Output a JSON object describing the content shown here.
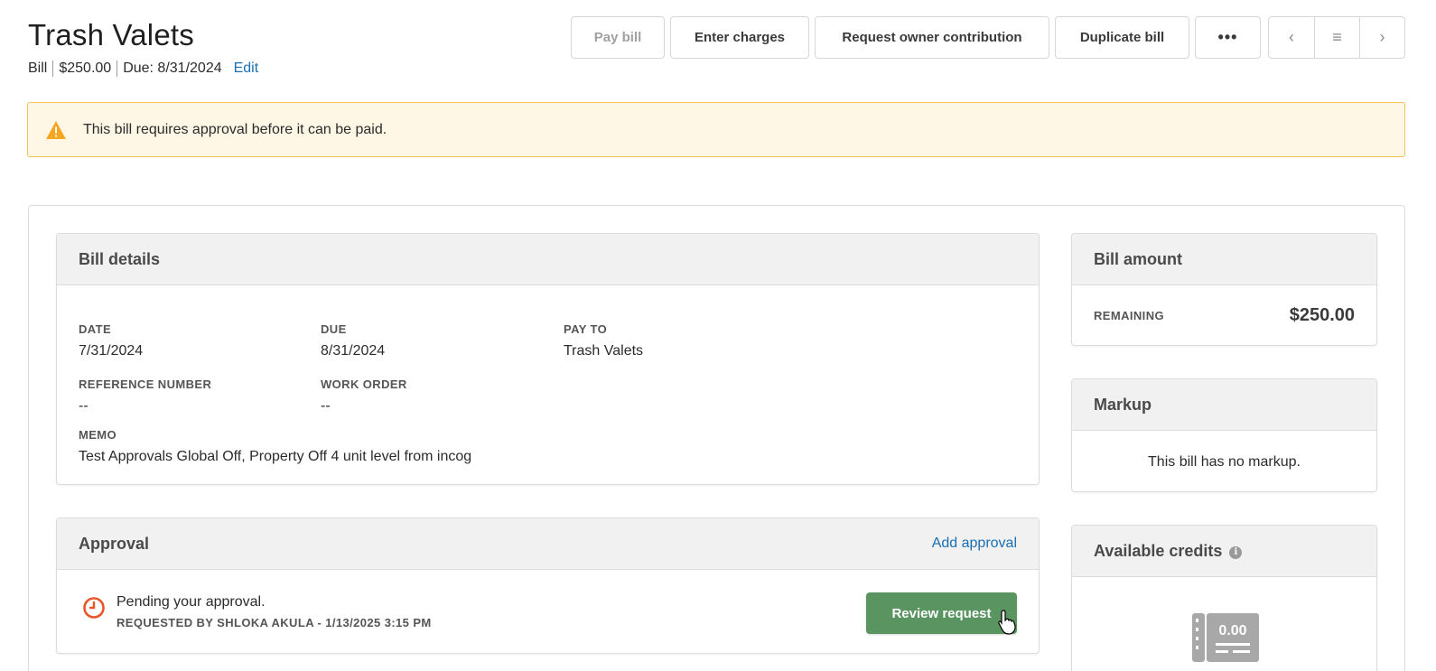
{
  "header": {
    "title": "Trash Valets",
    "type": "Bill",
    "amount": "$250.00",
    "due": "Due: 8/31/2024",
    "edit_label": "Edit"
  },
  "toolbar": {
    "pay_bill": "Pay bill",
    "enter_charges": "Enter charges",
    "request_owner_contribution": "Request owner contribution",
    "duplicate_bill": "Duplicate bill",
    "more": "•••",
    "prev": "‹",
    "list": "≡",
    "next": "›"
  },
  "banner": {
    "message": "This bill requires approval before it can be paid.",
    "icon": "warning-icon",
    "color": "#f3c358"
  },
  "bill_details": {
    "title": "Bill details",
    "date_label": "DATE",
    "date_value": "7/31/2024",
    "due_label": "DUE",
    "due_value": "8/31/2024",
    "pay_to_label": "PAY TO",
    "pay_to_value": "Trash Valets",
    "reference_label": "REFERENCE NUMBER",
    "reference_value": "--",
    "work_order_label": "WORK ORDER",
    "work_order_value": "--",
    "memo_label": "MEMO",
    "memo_value": "Test Approvals Global Off, Property Off 4 unit level from incog"
  },
  "approval": {
    "title": "Approval",
    "add_label": "Add approval",
    "status": "Pending your approval.",
    "requested_by": "REQUESTED BY SHLOKA AKULA - 1/13/2025 3:15 PM",
    "review_label": "Review request",
    "button_color": "#5a9461"
  },
  "bill_amount": {
    "title": "Bill amount",
    "remaining_label": "REMAINING",
    "remaining_value": "$250.00"
  },
  "markup": {
    "title": "Markup",
    "message": "This bill has no markup."
  },
  "credits": {
    "title": "Available credits",
    "icon_value": "0.00"
  }
}
